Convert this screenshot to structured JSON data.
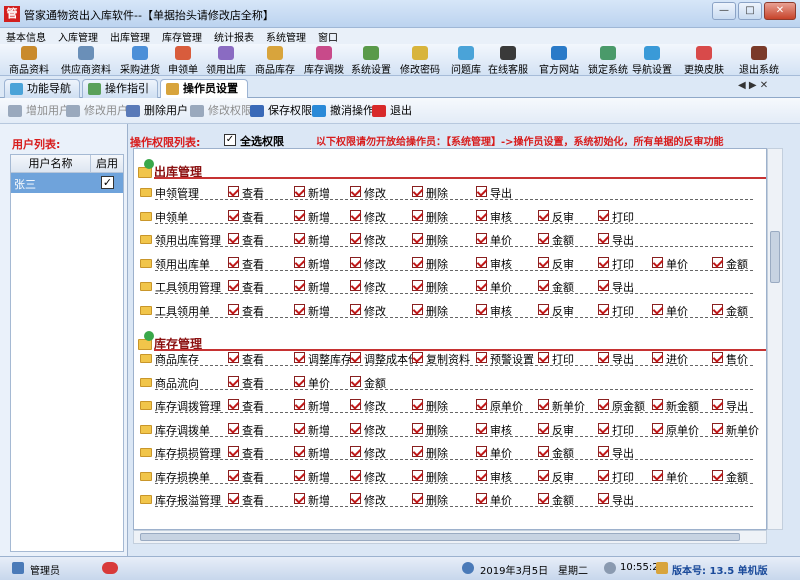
{
  "window": {
    "title": "管家通物资出入库软件--【单据抬头请修改店全称】",
    "controls": [
      "—",
      "□",
      "✕"
    ]
  },
  "menu": [
    "基本信息",
    "入库管理",
    "出库管理",
    "库存管理",
    "统计报表",
    "系统管理",
    "窗口"
  ],
  "toolbar": [
    {
      "label": "商品资料",
      "color": "#c98a2c"
    },
    {
      "label": "供应商资料",
      "color": "#6a8fb8"
    },
    {
      "label": "采购进货",
      "color": "#4c8fd8"
    },
    {
      "label": "申领单",
      "color": "#d85c3c"
    },
    {
      "label": "领用出库",
      "color": "#8a6bc2"
    },
    {
      "label": "商品库存",
      "color": "#d8a43c"
    },
    {
      "label": "库存调拨",
      "color": "#c84a8a"
    },
    {
      "label": "系统设置",
      "color": "#5a9a4a"
    },
    {
      "label": "修改密码",
      "color": "#d8b43c"
    },
    {
      "label": "问题库",
      "color": "#4aa3d8"
    },
    {
      "label": "在线客服",
      "color": "#3a3a3a"
    },
    {
      "label": "官方网站",
      "color": "#2a7ac8"
    },
    {
      "label": "锁定系统",
      "color": "#4a9a6a"
    },
    {
      "label": "导航设置",
      "color": "#3a9ad8"
    },
    {
      "label": "更换皮肤",
      "color": "#d84a4a"
    },
    {
      "label": "退出系统",
      "color": "#7a3a2a"
    }
  ],
  "tabs": [
    {
      "label": "功能导航",
      "active": false
    },
    {
      "label": "操作指引",
      "active": false
    },
    {
      "label": "操作员设置",
      "active": true
    }
  ],
  "tab_nav": "◀ ▶ ✕",
  "subtoolbar": [
    {
      "label": "增加用户",
      "enabled": false,
      "color": "#9aa9bd"
    },
    {
      "label": "修改用户",
      "enabled": false,
      "color": "#9aa9bd"
    },
    {
      "label": "删除用户",
      "enabled": true,
      "color": "#5a7ab8"
    },
    {
      "label": "修改权限",
      "enabled": false,
      "color": "#9aa9bd"
    },
    {
      "label": "保存权限",
      "enabled": true,
      "color": "#3a6ab8"
    },
    {
      "label": "撤消操作",
      "enabled": true,
      "color": "#2a8ad8"
    },
    {
      "label": "退出",
      "enabled": true,
      "color": "#d82a2a"
    }
  ],
  "user_list": {
    "title": "用户列表:",
    "columns": [
      "用户名称",
      "启用"
    ],
    "rows": [
      {
        "name": "张三",
        "enabled": true
      }
    ]
  },
  "permissions": {
    "title": "操作权限列表:",
    "select_all_label": "全选权限",
    "select_all_checked": true,
    "note": "以下权限请勿开放给操作员：【系统管理】->操作员设置，系统初始化，所有单据的反审功能",
    "sections": [
      {
        "title": "出库管理",
        "rows": [
          {
            "label": "申领管理",
            "perms": [
              "查看",
              "新增",
              "修改",
              "删除",
              "导出"
            ]
          },
          {
            "label": "申领单",
            "perms": [
              "查看",
              "新增",
              "修改",
              "删除",
              "审核",
              "反审",
              "打印"
            ]
          },
          {
            "label": "领用出库管理",
            "perms": [
              "查看",
              "新增",
              "修改",
              "删除",
              "单价",
              "金额",
              "导出"
            ]
          },
          {
            "label": "领用出库单",
            "perms": [
              "查看",
              "新增",
              "修改",
              "删除",
              "审核",
              "反审",
              "打印",
              "单价",
              "金额"
            ]
          },
          {
            "label": "工具领用管理",
            "perms": [
              "查看",
              "新增",
              "修改",
              "删除",
              "单价",
              "金额",
              "导出"
            ]
          },
          {
            "label": "工具领用单",
            "perms": [
              "查看",
              "新增",
              "修改",
              "删除",
              "审核",
              "反审",
              "打印",
              "单价",
              "金额"
            ]
          }
        ]
      },
      {
        "title": "库存管理",
        "rows": [
          {
            "label": "商品库存",
            "perms": [
              "查看",
              "调整库存",
              "调整成本价",
              "复制资料",
              "预警设置",
              "打印",
              "导出",
              "进价",
              "售价"
            ]
          },
          {
            "label": "商品流向",
            "perms": [
              "查看",
              "单价",
              "金额"
            ]
          },
          {
            "label": "库存调拨管理",
            "perms": [
              "查看",
              "新增",
              "修改",
              "删除",
              "原单价",
              "新单价",
              "原金额",
              "新金额",
              "导出"
            ]
          },
          {
            "label": "库存调拨单",
            "perms": [
              "查看",
              "新增",
              "修改",
              "删除",
              "审核",
              "反审",
              "打印",
              "原单价",
              "新单价"
            ]
          },
          {
            "label": "库存损损管理",
            "perms": [
              "查看",
              "新增",
              "修改",
              "删除",
              "单价",
              "金额",
              "导出"
            ]
          },
          {
            "label": "库存损换单",
            "perms": [
              "查看",
              "新增",
              "修改",
              "删除",
              "审核",
              "反审",
              "打印",
              "单价",
              "金额"
            ]
          },
          {
            "label": "库存报溢管理",
            "perms": [
              "查看",
              "新增",
              "修改",
              "删除",
              "单价",
              "金额",
              "导出"
            ]
          }
        ]
      }
    ]
  },
  "status": {
    "user": "管理员",
    "date": "2019年3月5日",
    "weekday": "星期二",
    "time": "10:55:26",
    "version": "版本号: 13.5 单机版"
  }
}
